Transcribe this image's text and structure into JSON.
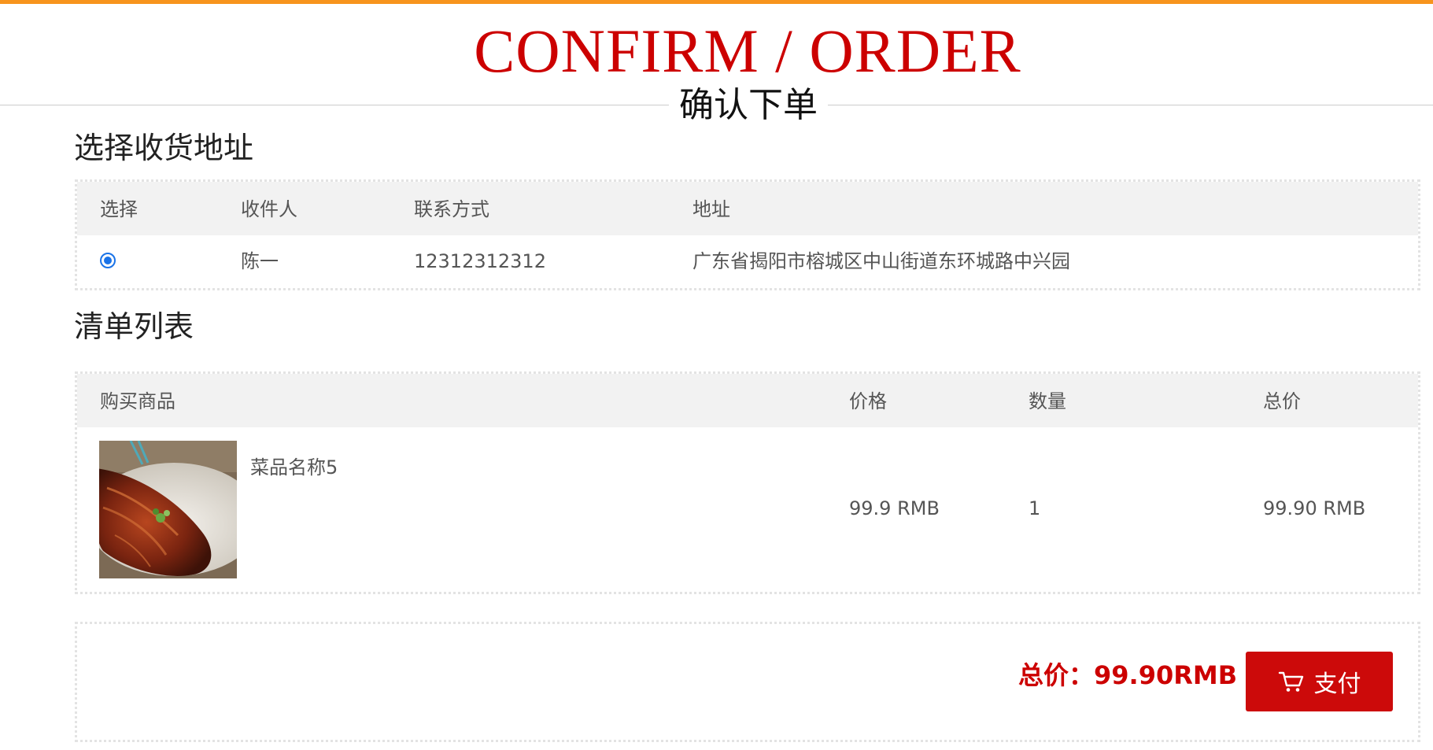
{
  "header": {
    "title_en": "CONFIRM / ORDER",
    "title_cn": "确认下单"
  },
  "address_section": {
    "title": "选择收货地址",
    "columns": [
      "选择",
      "收件人",
      "联系方式",
      "地址"
    ],
    "rows": [
      {
        "selected": true,
        "recipient": "陈一",
        "phone": "12312312312",
        "address": "广东省揭阳市榕城区中山街道东环城路中兴园"
      }
    ]
  },
  "list_section": {
    "title": "清单列表",
    "columns": [
      "购买商品",
      "价格",
      "数量",
      "总价"
    ],
    "rows": [
      {
        "name": "菜品名称5",
        "price": "99.9 RMB",
        "quantity": "1",
        "subtotal": "99.90 RMB"
      }
    ]
  },
  "footer": {
    "total_label": "总价：99.90RMB",
    "pay_label": "支付"
  },
  "colors": {
    "accent": "#f7941d",
    "brand_red": "#cc0000",
    "radio_blue": "#1a73e8"
  },
  "icons": {
    "pay": "cart-icon"
  }
}
